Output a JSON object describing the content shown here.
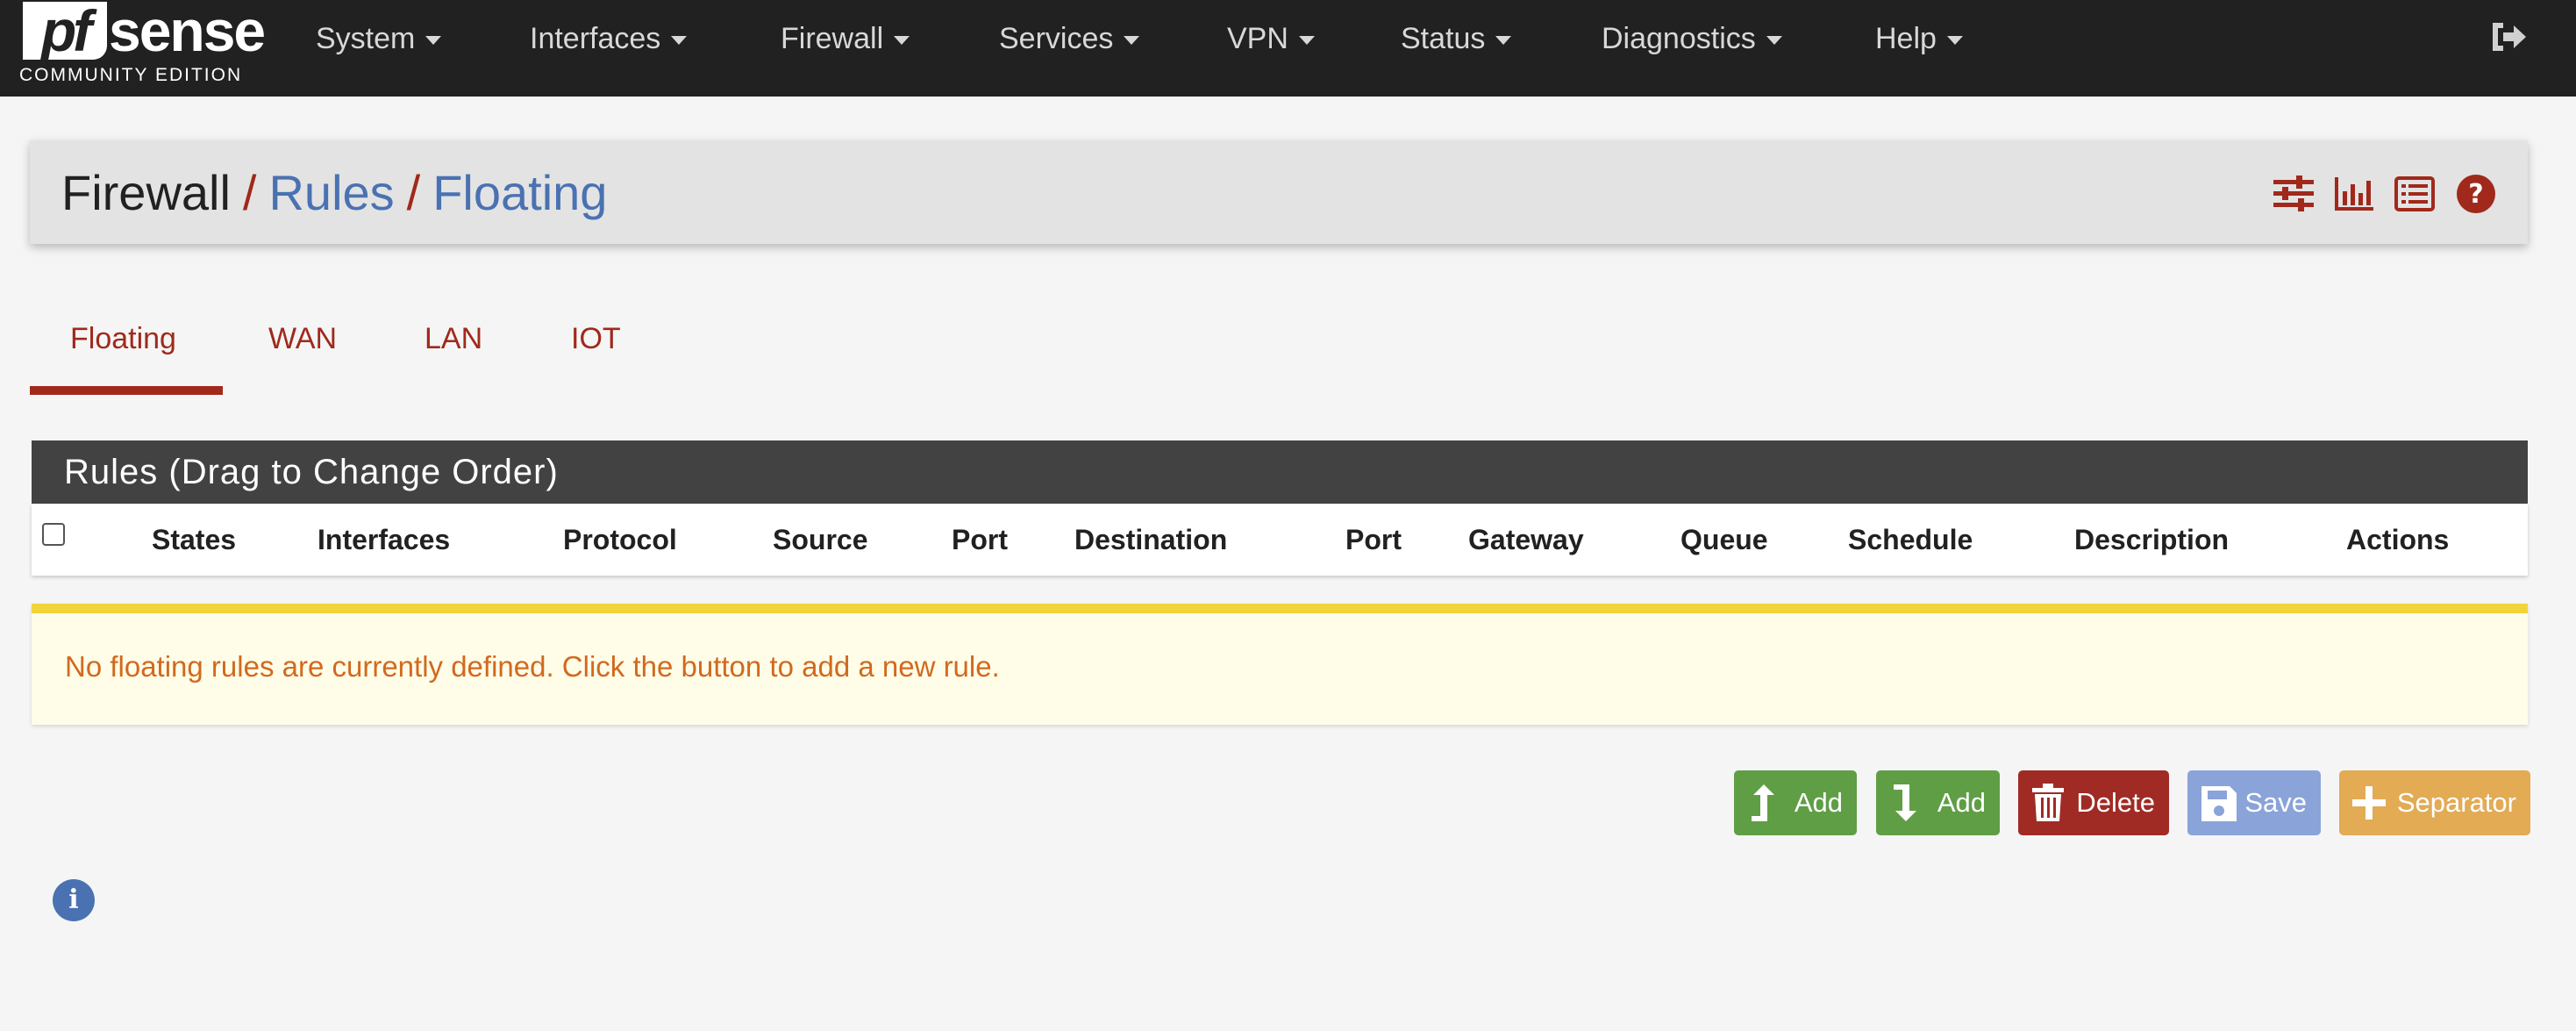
{
  "logo": {
    "part1": "pf",
    "part2": "sense",
    "subtitle": "COMMUNITY EDITION"
  },
  "nav": {
    "items": [
      {
        "label": "System"
      },
      {
        "label": "Interfaces"
      },
      {
        "label": "Firewall"
      },
      {
        "label": "Services"
      },
      {
        "label": "VPN"
      },
      {
        "label": "Status"
      },
      {
        "label": "Diagnostics"
      },
      {
        "label": "Help"
      }
    ],
    "logout_icon": "sign-out-icon"
  },
  "breadcrumb": {
    "root": "Firewall",
    "separator": "/",
    "items": [
      "Rules",
      "Floating"
    ]
  },
  "toolbar_icons": [
    "sliders-icon",
    "bar-chart-icon",
    "list-icon",
    "question-circle-icon"
  ],
  "tabs": [
    {
      "label": "Floating",
      "active": true
    },
    {
      "label": "WAN",
      "active": false
    },
    {
      "label": "LAN",
      "active": false
    },
    {
      "label": "IOT",
      "active": false
    }
  ],
  "rules_panel": {
    "title": "Rules (Drag to Change Order)",
    "columns": [
      "States",
      "Interfaces",
      "Protocol",
      "Source",
      "Port",
      "Destination",
      "Port",
      "Gateway",
      "Queue",
      "Schedule",
      "Description",
      "Actions"
    ]
  },
  "alert": {
    "message": "No floating rules are currently defined. Click the button to add a new rule."
  },
  "buttons": {
    "add_top": "Add",
    "add_bottom": "Add",
    "delete": "Delete",
    "save": "Save",
    "separator": "Separator"
  },
  "info_icon": "info-circle-icon",
  "colors": {
    "navbar": "#212121",
    "accent_red": "#a0291b",
    "link_blue": "#4a72b2",
    "btn_green": "#5f9e45",
    "btn_red": "#a02b25",
    "btn_blue": "#8aa4d9",
    "btn_orange": "#e2ab54",
    "alert_bg": "#fffde8",
    "alert_border": "#f0d43a",
    "alert_text": "#d2691e"
  }
}
